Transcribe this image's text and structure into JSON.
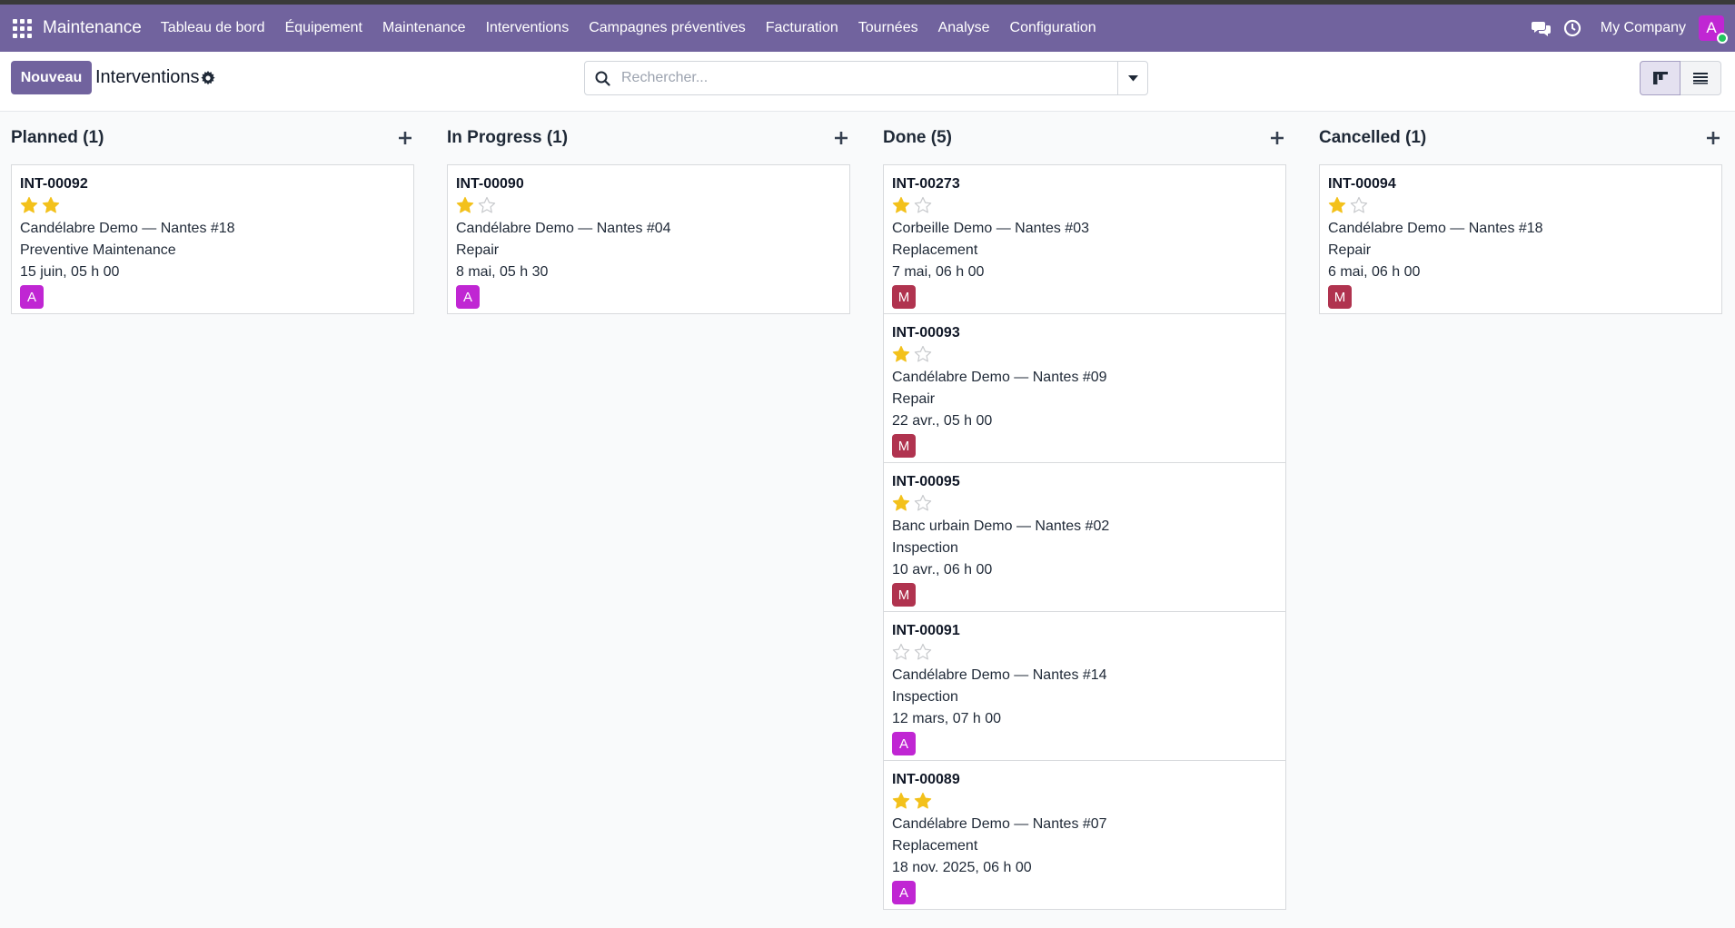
{
  "nav": {
    "brand": "Maintenance",
    "menu": [
      "Tableau de bord",
      "Équipement",
      "Maintenance",
      "Interventions",
      "Campagnes préventives",
      "Facturation",
      "Tournées",
      "Analyse",
      "Configuration"
    ],
    "company": "My Company",
    "user_initial": "A",
    "icons": [
      "apps-grid-icon",
      "chat-icon",
      "clock-icon"
    ],
    "brand_color": "#71639e"
  },
  "control": {
    "new_button": "Nouveau",
    "title": "Interventions",
    "search_placeholder": "Rechercher...",
    "search_value": "",
    "active_view": "kanban"
  },
  "columns": [
    {
      "title": "Planned (1)",
      "cards": [
        {
          "ref": "INT-00092",
          "stars": 2,
          "equipment": "Candélabre Demo — Nantes #18",
          "type": "Preventive Maintenance",
          "date": "15 juin, 05 h 00",
          "assignee": "A"
        }
      ]
    },
    {
      "title": "In Progress (1)",
      "cards": [
        {
          "ref": "INT-00090",
          "stars": 1,
          "equipment": "Candélabre Demo — Nantes #04",
          "type": "Repair",
          "date": "8 mai, 05 h 30",
          "assignee": "A"
        }
      ]
    },
    {
      "title": "Done (5)",
      "cards": [
        {
          "ref": "INT-00273",
          "stars": 1,
          "equipment": "Corbeille Demo — Nantes #03",
          "type": "Replacement",
          "date": "7 mai, 06 h 00",
          "assignee": "M"
        },
        {
          "ref": "INT-00093",
          "stars": 1,
          "equipment": "Candélabre Demo — Nantes #09",
          "type": "Repair",
          "date": "22 avr., 05 h 00",
          "assignee": "M"
        },
        {
          "ref": "INT-00095",
          "stars": 1,
          "equipment": "Banc urbain Demo — Nantes #02",
          "type": "Inspection",
          "date": "10 avr., 06 h 00",
          "assignee": "M"
        },
        {
          "ref": "INT-00091",
          "stars": 0,
          "equipment": "Candélabre Demo — Nantes #14",
          "type": "Inspection",
          "date": "12 mars, 07 h 00",
          "assignee": "A"
        },
        {
          "ref": "INT-00089",
          "stars": 2,
          "equipment": "Candélabre Demo — Nantes #07",
          "type": "Replacement",
          "date": "18 nov. 2025, 06 h 00",
          "assignee": "A"
        }
      ]
    },
    {
      "title": "Cancelled (1)",
      "cards": [
        {
          "ref": "INT-00094",
          "stars": 1,
          "equipment": "Candélabre Demo — Nantes #18",
          "type": "Repair",
          "date": "6 mai, 06 h 00",
          "assignee": "M"
        }
      ]
    }
  ]
}
